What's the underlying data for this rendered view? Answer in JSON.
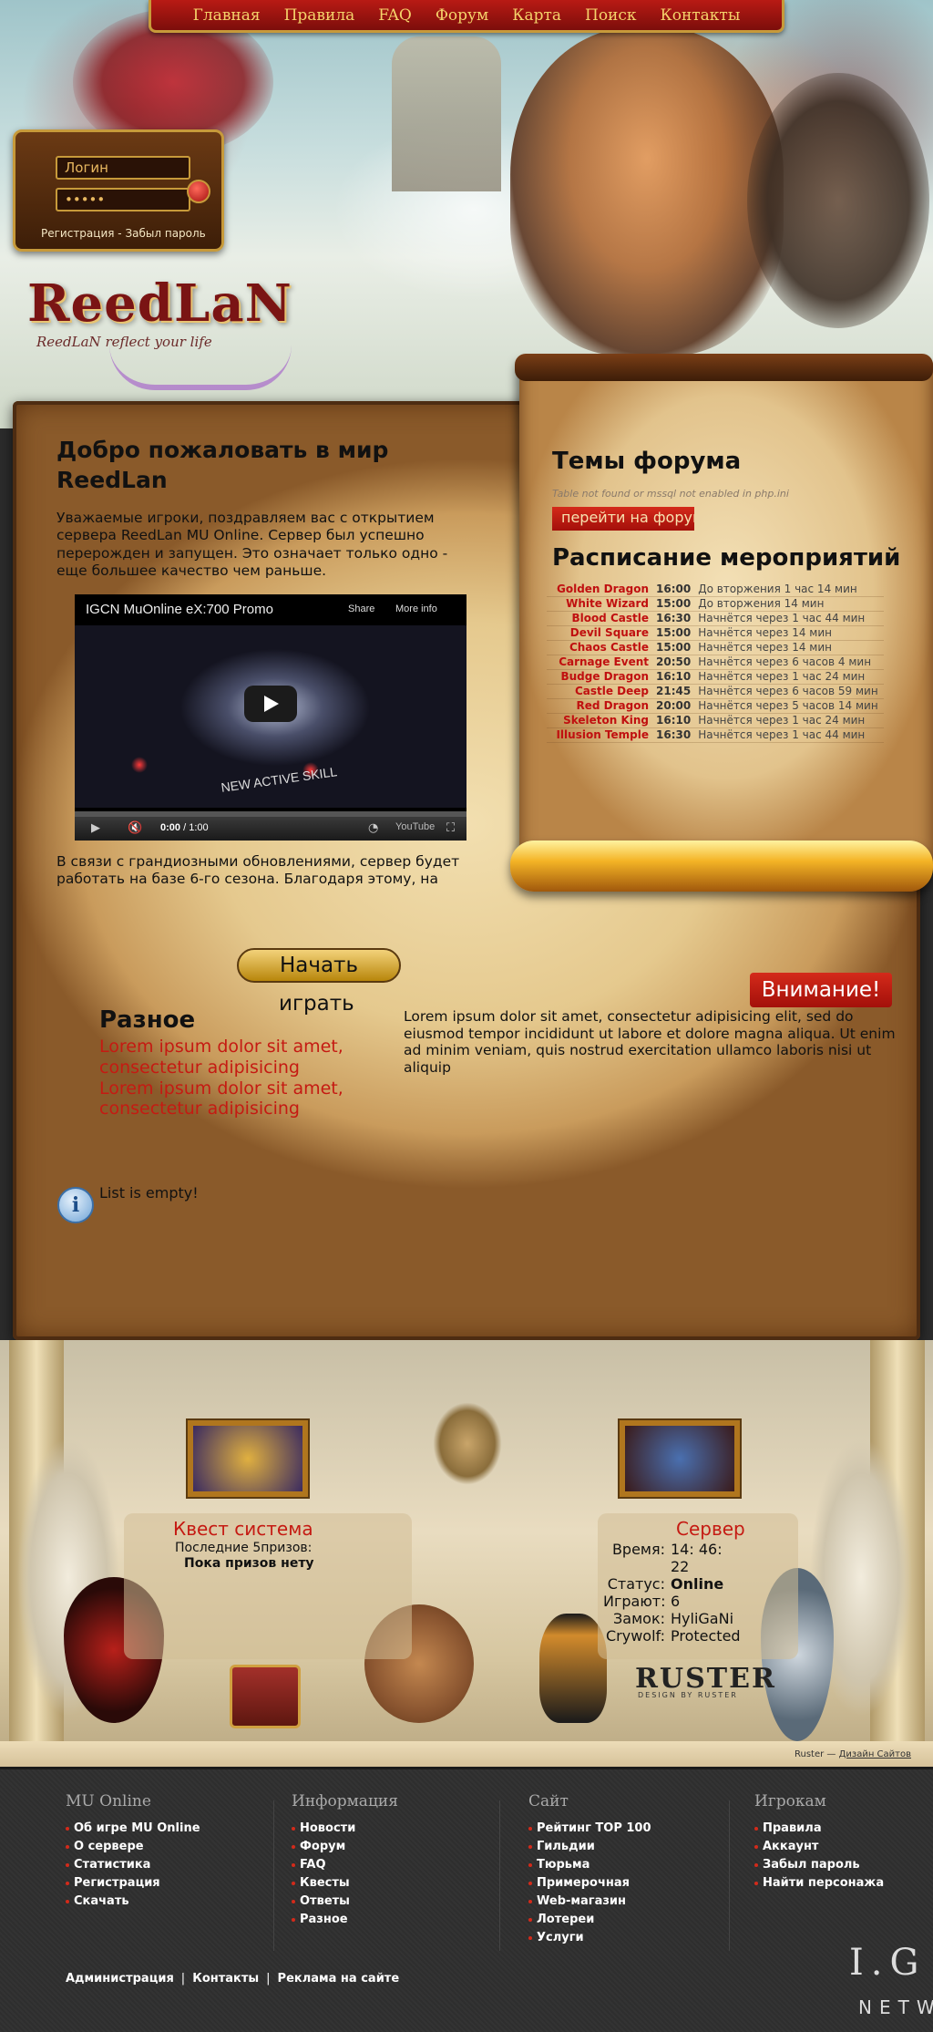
{
  "nav": {
    "items": [
      "Главная",
      "Правила",
      "FAQ",
      "Форум",
      "Карта",
      "Поиск",
      "Контакты"
    ]
  },
  "login": {
    "login_value": "Логин",
    "password_value": "•••••",
    "register_label": "Регистрация",
    "separator": " - ",
    "forgot_label": "Забыл пароль"
  },
  "logo": {
    "name": "ReedLaN",
    "tagline": "ReedLaN reflect your life"
  },
  "welcome": {
    "title": "Добро пожаловать в мир ReedLan",
    "text": "Уважаемые игроки, поздравляем вас с открытием сервера ReedLan MU Online. Сервер был успешно перерожден и запущен. Это означает только одно - еще большее качество чем раньше.",
    "after_video": "В связи с грандиозными обновлениями, сервер будет работать на базе 6-го сезона. Благодаря этому, на"
  },
  "video": {
    "title": "IGCN MuOnline eX:700 Promo",
    "share": "Share",
    "more_info": "More info",
    "skill_text": "NEW ACTIVE SKILL",
    "time_current": "0:00",
    "time_total": " / 1:00",
    "youtube_label": "YouTube"
  },
  "start": {
    "line1": "Начать",
    "line2": "играть"
  },
  "misc": {
    "title": "Разное",
    "items": [
      "Lorem ipsum dolor sit amet, consectetur adipisicing",
      "Lorem ipsum dolor sit amet, consectetur adipisicing"
    ]
  },
  "alert": {
    "label": "Внимание!",
    "text": "Lorem ipsum dolor sit amet, consectetur adipisicing elit, sed do eiusmod tempor incididunt ut labore et dolore magna aliqua. Ut enim ad minim veniam, quis nostrud exercitation ullamco laboris nisi ut aliquip"
  },
  "empty": {
    "icon": "info-icon",
    "message": "List is empty!"
  },
  "forum": {
    "title": "Темы форума",
    "error": "Table not found or mssql not enabled in php.ini",
    "button": "перейти на форум"
  },
  "events": {
    "title": "Расписание мероприятий",
    "rows": [
      {
        "name": "Golden Dragon",
        "time": "16:00",
        "state": "До вторжения 1 час 14 мин"
      },
      {
        "name": "White Wizard",
        "time": "15:00",
        "state": "До вторжения 14 мин"
      },
      {
        "name": "Blood Castle",
        "time": "16:30",
        "state": "Начнётся через 1 час 44 мин"
      },
      {
        "name": "Devil Square",
        "time": "15:00",
        "state": "Начнётся через 14 мин"
      },
      {
        "name": "Chaos Castle",
        "time": "15:00",
        "state": "Начнётся через 14 мин"
      },
      {
        "name": "Carnage Event",
        "time": "20:50",
        "state": "Начнётся через 6 часов 4 мин"
      },
      {
        "name": "Budge Dragon",
        "time": "16:10",
        "state": "Начнётся через 1 час 24 мин"
      },
      {
        "name": "Castle Deep",
        "time": "21:45",
        "state": "Начнётся через 6 часов 59 мин"
      },
      {
        "name": "Red Dragon",
        "time": "20:00",
        "state": "Начнётся через 5 часов 14 мин"
      },
      {
        "name": "Skeleton King",
        "time": "16:10",
        "state": "Начнётся через 1 час 24 мин"
      },
      {
        "name": "Illusion Temple",
        "time": "16:30",
        "state": "Начнётся через 1 час 44 мин"
      }
    ]
  },
  "quest": {
    "title": "Квест система",
    "subtitle": "Последние 5призов:",
    "none": "Пока призов нету"
  },
  "server": {
    "title": "Сервер",
    "rows": [
      {
        "label": "Время:",
        "value": "14: 46: 22",
        "bold": false
      },
      {
        "label": "Статус:",
        "value": "Online",
        "bold": true
      },
      {
        "label": "Играют:",
        "value": "6",
        "bold": false
      },
      {
        "label": "Замок:",
        "value": "HyliGaNi",
        "bold": false
      },
      {
        "label": "Crywolf:",
        "value": "Protected",
        "bold": false
      }
    ]
  },
  "ruster": {
    "logo": "RUSTER",
    "sub": "DESIGN BY RUSTER"
  },
  "credits": {
    "author": "Ruster — ",
    "link": "Дизайн Сайтов"
  },
  "footer": {
    "columns": [
      {
        "title": "MU Online",
        "items": [
          "Об игре MU Online",
          "О сервере",
          "Статистика",
          "Регистрация",
          "Скачать"
        ]
      },
      {
        "title": "Информация",
        "items": [
          "Новости",
          "Форум",
          "FAQ",
          "Квесты",
          "Ответы",
          "Разное"
        ]
      },
      {
        "title": "Сайт",
        "items": [
          "Рейтинг TOP 100",
          "Гильдии",
          "Тюрьма",
          "Примерочная",
          "Web-магазин",
          "Лотереи",
          "Услуги"
        ]
      },
      {
        "title": "Игрокам",
        "items": [
          "Правила",
          "Аккаунт",
          "Забыл пароль",
          "Найти персонажа"
        ]
      }
    ],
    "links": [
      "Администрация",
      "Контакты",
      "Реклама на сайте"
    ],
    "igcn": "I.G",
    "igcn_sub": "NETW"
  },
  "colors": {
    "accent_red": "#c51a12",
    "gold": "#c79a3a",
    "parchment": "#e5c98e"
  }
}
